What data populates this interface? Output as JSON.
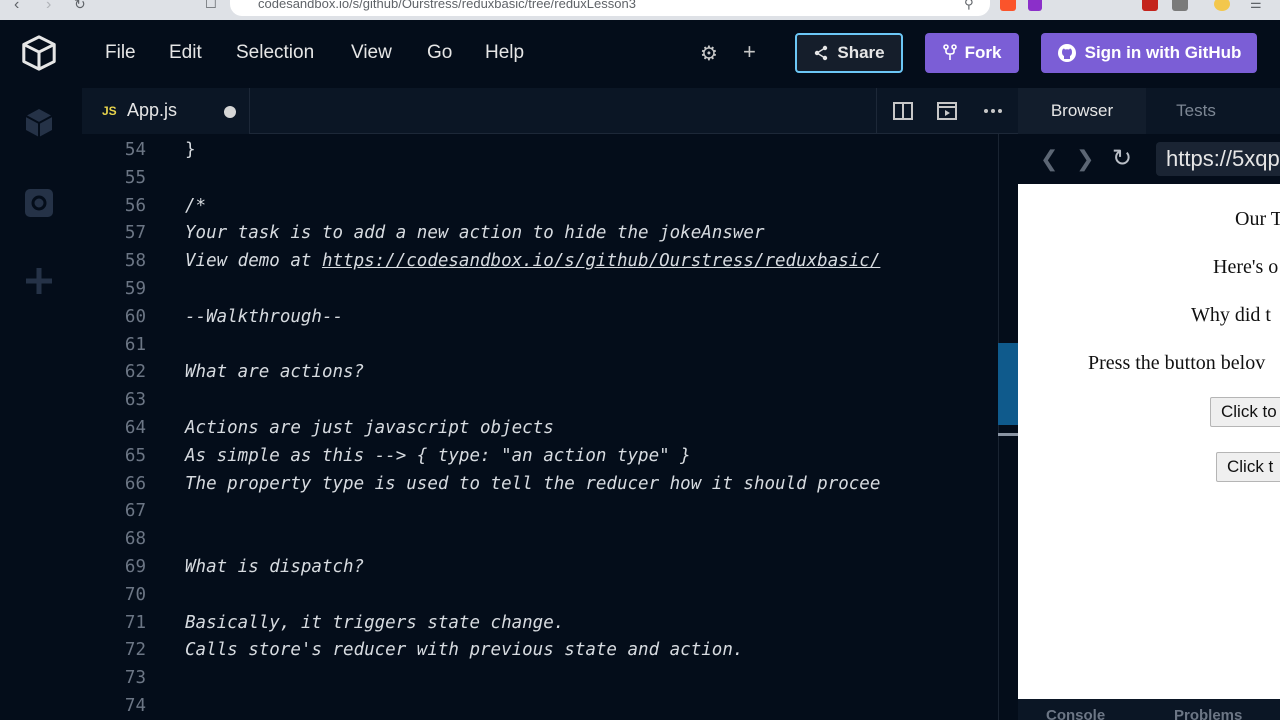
{
  "browser": {
    "url": "codesandbox.io/s/github/Ourstress/reduxbasic/tree/reduxLesson3"
  },
  "header": {
    "menu": [
      "File",
      "Edit",
      "Selection",
      "View",
      "Go",
      "Help"
    ],
    "share_label": "Share",
    "fork_label": "Fork",
    "github_label": "Sign in with GitHub"
  },
  "editor_tab": {
    "lang_badge": "JS",
    "filename": "App.js"
  },
  "code_lines": [
    {
      "n": "54",
      "t": "}"
    },
    {
      "n": "55",
      "t": ""
    },
    {
      "n": "56",
      "t": "/*"
    },
    {
      "n": "57",
      "t": "Your task is to add a new action to hide the jokeAnswer"
    },
    {
      "n": "58",
      "t": "View demo at ",
      "link": "https://codesandbox.io/s/github/Ourstress/reduxbasic/"
    },
    {
      "n": "59",
      "t": ""
    },
    {
      "n": "60",
      "t": "--Walkthrough--"
    },
    {
      "n": "61",
      "t": ""
    },
    {
      "n": "62",
      "t": "What are actions?"
    },
    {
      "n": "63",
      "t": ""
    },
    {
      "n": "64",
      "t": "Actions are just javascript objects"
    },
    {
      "n": "65",
      "t": "As simple as this --> { type: \"an action type\" }"
    },
    {
      "n": "66",
      "t": "The property type is used to tell the reducer how it should procee"
    },
    {
      "n": "67",
      "t": ""
    },
    {
      "n": "68",
      "t": ""
    },
    {
      "n": "69",
      "t": "What is dispatch?"
    },
    {
      "n": "70",
      "t": ""
    },
    {
      "n": "71",
      "t": "Basically, it triggers state change."
    },
    {
      "n": "72",
      "t": "Calls store's reducer with previous state and action."
    },
    {
      "n": "73",
      "t": ""
    },
    {
      "n": "74",
      "t": ""
    }
  ],
  "right_panel": {
    "tab_browser": "Browser",
    "tab_tests": "Tests",
    "url": "https://5xqp",
    "preview": {
      "line1": "Our T",
      "line2": "Here's o",
      "line3": "Why did t",
      "line4": "Press the button belov",
      "button1": "Click to",
      "button2": "Click t"
    },
    "bottom_tabs": [
      "Console",
      "Problems"
    ]
  }
}
